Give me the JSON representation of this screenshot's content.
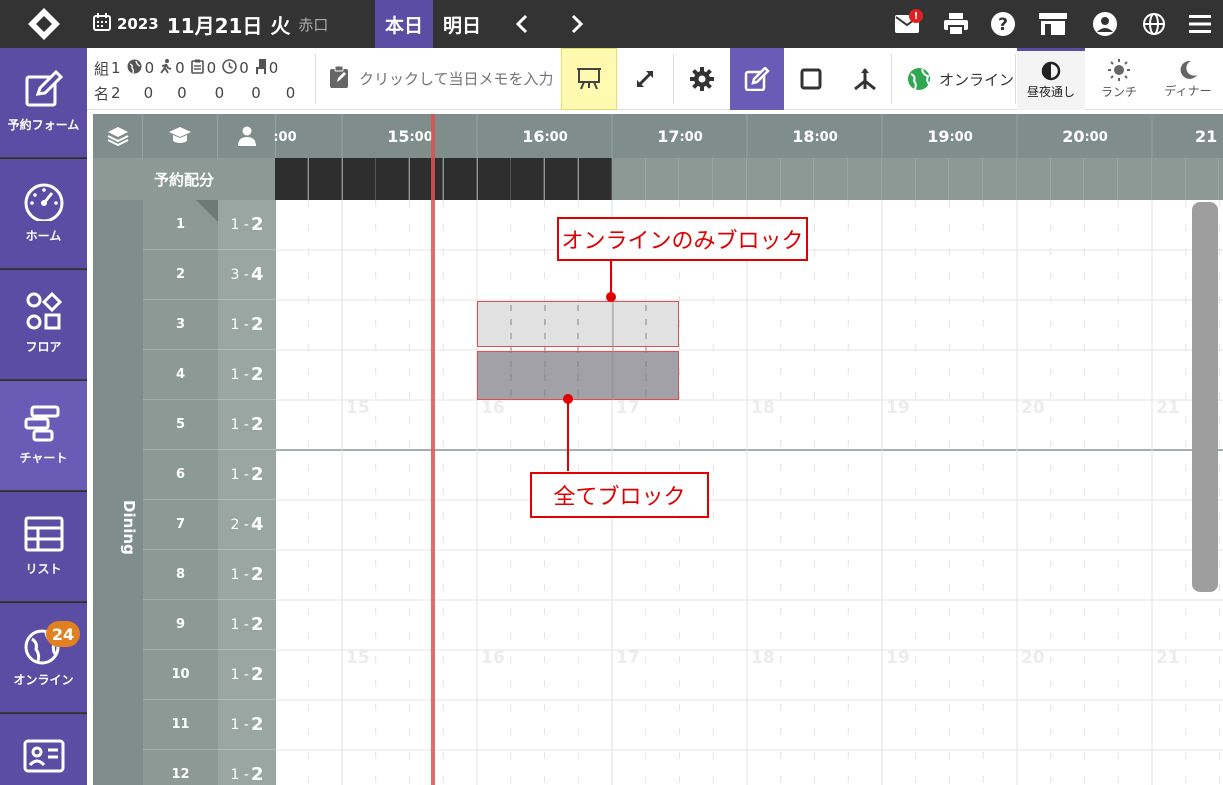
{
  "header": {
    "year": "2023",
    "month_day": "11月21日",
    "day_of_week": "火",
    "rokuyo": "赤口",
    "today_label": "本日",
    "tomorrow_label": "明日",
    "mail_badge": "!",
    "icons": [
      "calendar-icon",
      "mail-icon",
      "print-icon",
      "help-icon",
      "store-icon",
      "account-icon",
      "globe-icon",
      "menu-icon"
    ]
  },
  "sidebar": {
    "items": [
      {
        "label": "予約フォーム",
        "icon": "pen-icon"
      },
      {
        "label": "ホーム",
        "icon": "gauge-icon"
      },
      {
        "label": "フロア",
        "icon": "shapes-icon"
      },
      {
        "label": "チャート",
        "icon": "chart-icon"
      },
      {
        "label": "リスト",
        "icon": "table-icon"
      },
      {
        "label": "オンライン",
        "icon": "globe-icon",
        "badge": "24"
      },
      {
        "label": "",
        "icon": "contact-card-icon"
      }
    ]
  },
  "toolbar": {
    "stats": {
      "row1_label": "組",
      "row1_value": "1",
      "row2_label": "名",
      "row2_value": "2",
      "online_groups": "0",
      "walkin_groups": "0",
      "clipboard_groups": "0",
      "clock_groups": "0",
      "chair_groups": "0",
      "online_people": "0",
      "walkin_people": "0",
      "clipboard_people": "0",
      "clock_people": "0",
      "chair_people": "0"
    },
    "memo_placeholder": "クリックして当日メモを入力",
    "online_label": "オンライン",
    "modes": [
      {
        "label": "昼夜通し",
        "icon": "half-moon-icon",
        "active": true
      },
      {
        "label": "ランチ",
        "icon": "sun-icon",
        "active": false
      },
      {
        "label": "ディナー",
        "icon": "moon-icon",
        "active": false
      }
    ]
  },
  "chart": {
    "time_labels": [
      {
        "hour": "",
        "min": ":00"
      },
      {
        "hour": "15",
        "min": ":00"
      },
      {
        "hour": "16",
        "min": ":00"
      },
      {
        "hour": "17",
        "min": ":00"
      },
      {
        "hour": "18",
        "min": ":00"
      },
      {
        "hour": "19",
        "min": ":00"
      },
      {
        "hour": "20",
        "min": ":00"
      },
      {
        "hour": "21",
        "min": ""
      }
    ],
    "alloc_label": "予約配分",
    "section_label": "Dining",
    "watermark_hours": [
      "15",
      "16",
      "17",
      "18",
      "19",
      "20",
      "21"
    ],
    "tables": [
      {
        "num": "1",
        "cap_min": "1",
        "cap_max": "2"
      },
      {
        "num": "2",
        "cap_min": "3",
        "cap_max": "4"
      },
      {
        "num": "3",
        "cap_min": "1",
        "cap_max": "2"
      },
      {
        "num": "4",
        "cap_min": "1",
        "cap_max": "2"
      },
      {
        "num": "5",
        "cap_min": "1",
        "cap_max": "2"
      },
      {
        "num": "6",
        "cap_min": "1",
        "cap_max": "2"
      },
      {
        "num": "7",
        "cap_min": "2",
        "cap_max": "4"
      },
      {
        "num": "8",
        "cap_min": "1",
        "cap_max": "2"
      },
      {
        "num": "9",
        "cap_min": "1",
        "cap_max": "2"
      },
      {
        "num": "10",
        "cap_min": "1",
        "cap_max": "2"
      },
      {
        "num": "11",
        "cap_min": "1",
        "cap_max": "2"
      },
      {
        "num": "12",
        "cap_min": "1",
        "cap_max": "2"
      }
    ]
  },
  "annotations": {
    "online_only_block": "オンラインのみブロック",
    "all_block": "全てブロック"
  },
  "colors": {
    "accent": "#5b4da3",
    "header_gray": "#7f8e8a",
    "current_time_line": "#d9534f",
    "callout_red": "#e00000"
  }
}
